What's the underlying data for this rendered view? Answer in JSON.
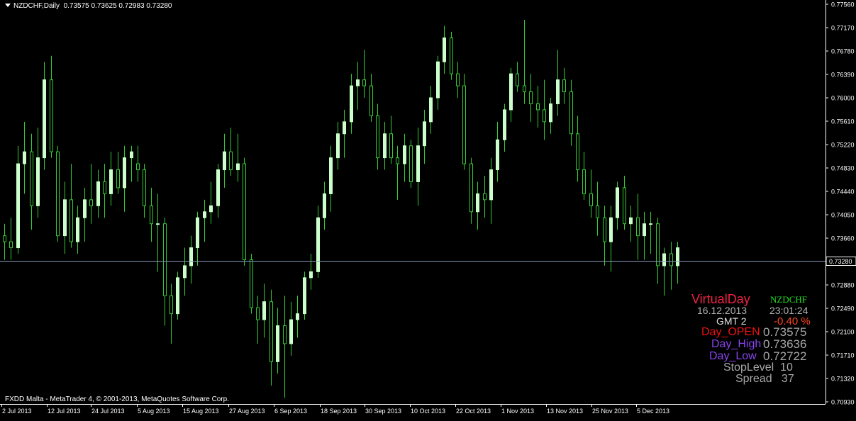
{
  "header": {
    "symbol_timeframe": "NZDCHF,Daily",
    "ohlc": "0.73575 0.73625 0.72983 0.73280"
  },
  "footer": {
    "copyright": "FXDD Malta - MetaTrader 4, © 2001-2013, MetaQuotes Software Corp."
  },
  "colors": {
    "background": "#000000",
    "candle_bull_fill": "#ccffcc",
    "candle_wick": "#33cc33",
    "grid_text": "#ffffff",
    "bid_line": "#8899bb",
    "virtual_day": "#ee2244",
    "symbol": "#22dd22",
    "gray_text": "#b0b0b0",
    "change_text": "#ff4422",
    "day_open": "#ee1111",
    "day_high_low": "#8844ee"
  },
  "indicator": {
    "title": "VirtualDay",
    "symbol": "NZDCHF",
    "date": "16.12.2013",
    "time": "23:01:24",
    "gmt": "GMT 2",
    "change": "-0.40 %",
    "day_open_label": "Day_OPEN",
    "day_open_value": "0.73575",
    "day_high_label": "Day_High",
    "day_high_value": "0.73636",
    "day_low_label": "Day_Low",
    "day_low_value": "0.72722",
    "stoplevel": "StopLevel  10",
    "spread": "Spread   37"
  },
  "chart_data": {
    "type": "candlestick",
    "symbol": "NZDCHF",
    "timeframe": "Daily",
    "ylim": [
      0.7093,
      0.7756
    ],
    "current_price": 0.7328,
    "price_ticks": [
      "0.77560",
      "0.77170",
      "0.76780",
      "0.76390",
      "0.76000",
      "0.75610",
      "0.75220",
      "0.74830",
      "0.74440",
      "0.74050",
      "0.73660",
      "0.72880",
      "0.72490",
      "0.72100",
      "0.71710",
      "0.71320",
      "0.70930"
    ],
    "current_price_label": "0.73280",
    "date_ticks": [
      "2 Jul 2013",
      "12 Jul 2013",
      "24 Jul 2013",
      "5 Aug 2013",
      "15 Aug 2013",
      "27 Aug 2013",
      "6 Sep 2013",
      "18 Sep 2013",
      "30 Sep 2013",
      "10 Oct 2013",
      "22 Oct 2013",
      "1 Nov 2013",
      "13 Nov 2013",
      "25 Nov 2013",
      "5 Dec 2013"
    ],
    "candles": [
      [
        0.737,
        0.739,
        0.733,
        0.736
      ],
      [
        0.736,
        0.74,
        0.733,
        0.735
      ],
      [
        0.735,
        0.752,
        0.734,
        0.749
      ],
      [
        0.749,
        0.756,
        0.744,
        0.751
      ],
      [
        0.751,
        0.754,
        0.738,
        0.742
      ],
      [
        0.742,
        0.755,
        0.74,
        0.75
      ],
      [
        0.75,
        0.766,
        0.748,
        0.763
      ],
      [
        0.763,
        0.767,
        0.75,
        0.751
      ],
      [
        0.751,
        0.752,
        0.736,
        0.737
      ],
      [
        0.737,
        0.746,
        0.734,
        0.743
      ],
      [
        0.743,
        0.749,
        0.735,
        0.736
      ],
      [
        0.736,
        0.742,
        0.734,
        0.74
      ],
      [
        0.74,
        0.745,
        0.736,
        0.743
      ],
      [
        0.743,
        0.749,
        0.739,
        0.742
      ],
      [
        0.742,
        0.748,
        0.74,
        0.746
      ],
      [
        0.746,
        0.749,
        0.74,
        0.744
      ],
      [
        0.744,
        0.751,
        0.742,
        0.748
      ],
      [
        0.748,
        0.751,
        0.744,
        0.745
      ],
      [
        0.745,
        0.752,
        0.741,
        0.75
      ],
      [
        0.75,
        0.752,
        0.746,
        0.751
      ],
      [
        0.749,
        0.752,
        0.746,
        0.748
      ],
      [
        0.748,
        0.749,
        0.74,
        0.742
      ],
      [
        0.742,
        0.745,
        0.736,
        0.739
      ],
      [
        0.739,
        0.744,
        0.731,
        0.739
      ],
      [
        0.739,
        0.74,
        0.722,
        0.727
      ],
      [
        0.727,
        0.729,
        0.719,
        0.724
      ],
      [
        0.724,
        0.731,
        0.723,
        0.73
      ],
      [
        0.73,
        0.735,
        0.727,
        0.732
      ],
      [
        0.732,
        0.737,
        0.729,
        0.735
      ],
      [
        0.735,
        0.741,
        0.732,
        0.74
      ],
      [
        0.74,
        0.743,
        0.736,
        0.741
      ],
      [
        0.741,
        0.746,
        0.739,
        0.742
      ],
      [
        0.742,
        0.749,
        0.74,
        0.748
      ],
      [
        0.748,
        0.754,
        0.745,
        0.751
      ],
      [
        0.751,
        0.755,
        0.747,
        0.748
      ],
      [
        0.748,
        0.754,
        0.746,
        0.749
      ],
      [
        0.749,
        0.75,
        0.732,
        0.733
      ],
      [
        0.733,
        0.734,
        0.724,
        0.725
      ],
      [
        0.725,
        0.727,
        0.719,
        0.723
      ],
      [
        0.723,
        0.729,
        0.72,
        0.726
      ],
      [
        0.726,
        0.728,
        0.712,
        0.716
      ],
      [
        0.716,
        0.725,
        0.714,
        0.722
      ],
      [
        0.722,
        0.727,
        0.71,
        0.719
      ],
      [
        0.719,
        0.726,
        0.717,
        0.723
      ],
      [
        0.723,
        0.727,
        0.72,
        0.724
      ],
      [
        0.724,
        0.731,
        0.723,
        0.73
      ],
      [
        0.73,
        0.734,
        0.728,
        0.731
      ],
      [
        0.731,
        0.742,
        0.73,
        0.74
      ],
      [
        0.74,
        0.746,
        0.738,
        0.744
      ],
      [
        0.744,
        0.752,
        0.741,
        0.75
      ],
      [
        0.75,
        0.756,
        0.748,
        0.754
      ],
      [
        0.754,
        0.758,
        0.75,
        0.756
      ],
      [
        0.756,
        0.764,
        0.754,
        0.762
      ],
      [
        0.762,
        0.766,
        0.758,
        0.763
      ],
      [
        0.763,
        0.768,
        0.76,
        0.762
      ],
      [
        0.762,
        0.764,
        0.756,
        0.757
      ],
      [
        0.757,
        0.759,
        0.748,
        0.75
      ],
      [
        0.75,
        0.756,
        0.748,
        0.754
      ],
      [
        0.754,
        0.757,
        0.749,
        0.75
      ],
      [
        0.75,
        0.752,
        0.743,
        0.749
      ],
      [
        0.749,
        0.754,
        0.746,
        0.752
      ],
      [
        0.752,
        0.753,
        0.745,
        0.746
      ],
      [
        0.746,
        0.755,
        0.742,
        0.752
      ],
      [
        0.752,
        0.758,
        0.749,
        0.756
      ],
      [
        0.756,
        0.762,
        0.754,
        0.76
      ],
      [
        0.76,
        0.767,
        0.758,
        0.766
      ],
      [
        0.766,
        0.772,
        0.764,
        0.77
      ],
      [
        0.77,
        0.771,
        0.763,
        0.764
      ],
      [
        0.764,
        0.766,
        0.76,
        0.762
      ],
      [
        0.762,
        0.764,
        0.748,
        0.749
      ],
      [
        0.749,
        0.75,
        0.739,
        0.741
      ],
      [
        0.741,
        0.746,
        0.738,
        0.744
      ],
      [
        0.744,
        0.747,
        0.74,
        0.743
      ],
      [
        0.743,
        0.75,
        0.739,
        0.748
      ],
      [
        0.748,
        0.756,
        0.746,
        0.753
      ],
      [
        0.753,
        0.759,
        0.751,
        0.758
      ],
      [
        0.758,
        0.765,
        0.756,
        0.764
      ],
      [
        0.764,
        0.766,
        0.761,
        0.762
      ],
      [
        0.762,
        0.773,
        0.759,
        0.761
      ],
      [
        0.761,
        0.764,
        0.756,
        0.759
      ],
      [
        0.759,
        0.762,
        0.755,
        0.758
      ],
      [
        0.758,
        0.763,
        0.753,
        0.756
      ],
      [
        0.756,
        0.76,
        0.754,
        0.759
      ],
      [
        0.759,
        0.768,
        0.757,
        0.763
      ],
      [
        0.763,
        0.765,
        0.759,
        0.761
      ],
      [
        0.761,
        0.763,
        0.752,
        0.754
      ],
      [
        0.754,
        0.757,
        0.746,
        0.748
      ],
      [
        0.748,
        0.751,
        0.743,
        0.744
      ],
      [
        0.744,
        0.748,
        0.74,
        0.742
      ],
      [
        0.742,
        0.746,
        0.737,
        0.74
      ],
      [
        0.74,
        0.742,
        0.732,
        0.736
      ],
      [
        0.736,
        0.742,
        0.731,
        0.74
      ],
      [
        0.74,
        0.746,
        0.738,
        0.745
      ],
      [
        0.745,
        0.747,
        0.738,
        0.739
      ],
      [
        0.739,
        0.742,
        0.736,
        0.74
      ],
      [
        0.74,
        0.744,
        0.733,
        0.737
      ],
      [
        0.737,
        0.741,
        0.733,
        0.739
      ],
      [
        0.739,
        0.741,
        0.734,
        0.739
      ],
      [
        0.739,
        0.74,
        0.729,
        0.732
      ],
      [
        0.732,
        0.735,
        0.727,
        0.734
      ],
      [
        0.734,
        0.736,
        0.728,
        0.732
      ],
      [
        0.732,
        0.736,
        0.729,
        0.735
      ]
    ]
  }
}
